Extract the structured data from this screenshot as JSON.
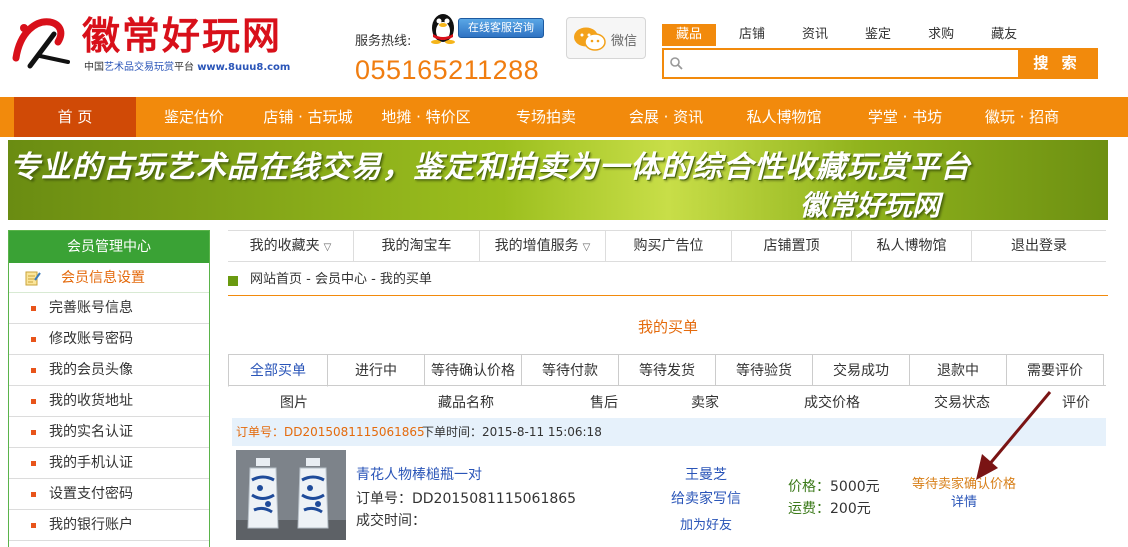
{
  "header": {
    "logo_text": "徽常好玩网",
    "logo_sub_prefix": "中国",
    "logo_sub_highlight": "艺术品交易玩赏",
    "logo_sub_suffix": "平台",
    "logo_url": "www.8uuu8.com",
    "hotline_label": "服务热线:",
    "qq_button": "在线客服咨询",
    "phone": "055165211288",
    "wechat_label": "微信"
  },
  "search": {
    "tabs": [
      "藏品",
      "店铺",
      "资讯",
      "鉴定",
      "求购",
      "藏友"
    ],
    "active_tab": 0,
    "value": "",
    "button": "搜 索"
  },
  "nav": {
    "items": [
      "首 页",
      "鉴定估价",
      "店铺 · 古玩城",
      "地摊 · 特价区",
      "专场拍卖",
      "会展 · 资讯",
      "私人博物馆",
      "学堂 · 书坊",
      "徽玩 · 招商"
    ],
    "active": 0
  },
  "banner": {
    "line1": "专业的古玩艺术品在线交易，鉴定和拍卖为一体的综合性收藏玩赏平台",
    "line2": "徽常好玩网"
  },
  "sidebar": {
    "title": "会员管理中心",
    "section": "会员信息设置",
    "items": [
      "完善账号信息",
      "修改账号密码",
      "我的会员头像",
      "我的收货地址",
      "我的实名认证",
      "我的手机认证",
      "设置支付密码",
      "我的银行账户"
    ]
  },
  "subnav": {
    "items": [
      "我的收藏夹",
      "我的淘宝车",
      "我的增值服务",
      "购买广告位",
      "店铺置顶",
      "私人博物馆",
      "退出登录"
    ],
    "caret": "▽"
  },
  "breadcrumb": {
    "text": "网站首页 - 会员中心 - 我的买单"
  },
  "page_title": "我的买单",
  "tabs": {
    "items": [
      "全部买单",
      "进行中",
      "等待确认价格",
      "等待付款",
      "等待发货",
      "等待验货",
      "交易成功",
      "退款中",
      "需要评价"
    ],
    "active": 0
  },
  "columns": [
    "图片",
    "藏品名称",
    "售后",
    "卖家",
    "成交价格",
    "交易状态",
    "评价"
  ],
  "order": {
    "order_no_label": "订单号：",
    "order_no": "DD2015081115061865",
    "time_label": "下单时间：",
    "time": "2015-8-11 15:06:18",
    "item_name": "青花人物棒槌瓶一对",
    "item_orderno_label": "订单号：",
    "item_orderno": "DD2015081115061865",
    "deal_time_label": "成交时间：",
    "deal_time": "",
    "seller_name": "王曼芝",
    "seller_msg": "给卖家写信",
    "seller_friend": "加为好友",
    "price_label": "价格：",
    "price": "5000元",
    "shipping_label": "运费：",
    "shipping": "200元",
    "status": "等待卖家确认价格",
    "detail": "详情"
  },
  "colors": {
    "brand_orange": "#f28a0c",
    "nav_active": "#d04a06",
    "sidebar_green": "#3aa235",
    "link_blue": "#2a55b8",
    "logo_red": "#d8101a"
  }
}
